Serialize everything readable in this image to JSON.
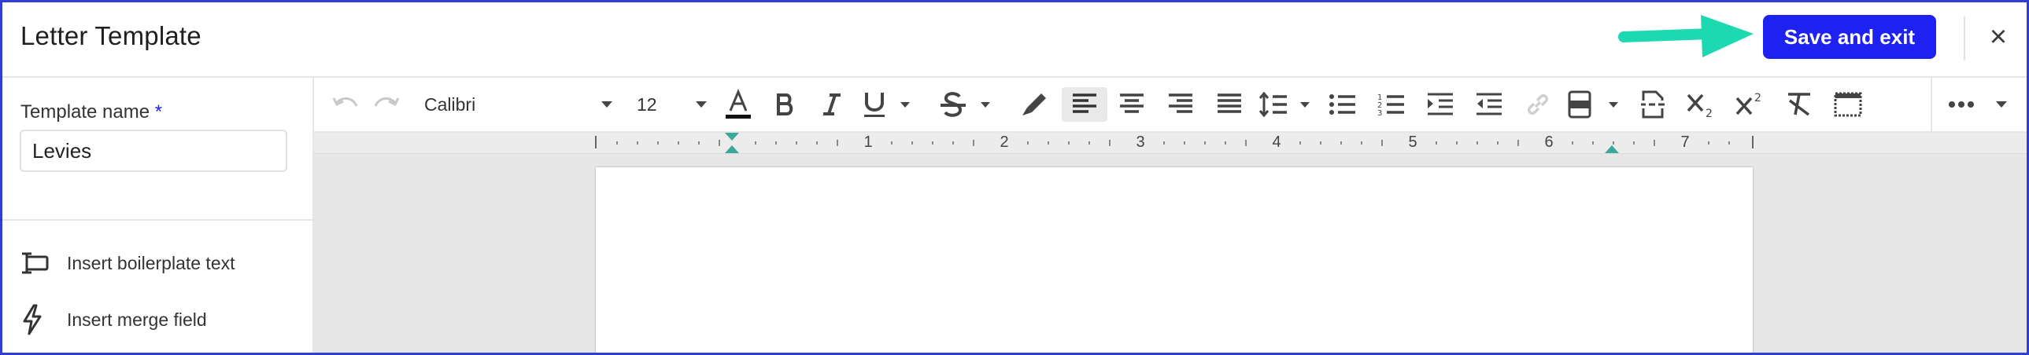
{
  "header": {
    "title": "Letter Template",
    "save_label": "Save and exit",
    "close_label": "×"
  },
  "sidebar": {
    "template_name_label": "Template name",
    "required_marker": "*",
    "template_name_value": "Levies",
    "actions": [
      {
        "label": "Insert boilerplate text",
        "icon": "boilerplate-icon"
      },
      {
        "label": "Insert merge field",
        "icon": "lightning-icon"
      }
    ]
  },
  "toolbar": {
    "font_family": "Calibri",
    "font_size": "12",
    "buttons": [
      "undo-icon",
      "redo-icon",
      "text-color-icon",
      "bold-icon",
      "italic-icon",
      "underline-icon",
      "strikethrough-icon",
      "highlight-icon",
      "align-left-icon",
      "align-center-icon",
      "align-right-icon",
      "justify-icon",
      "line-spacing-icon",
      "bullet-list-icon",
      "numbered-list-icon",
      "indent-icon",
      "outdent-icon",
      "link-icon",
      "page-break-icon",
      "header-footer-icon",
      "subscript-icon",
      "superscript-icon",
      "clear-formatting-icon",
      "table-icon",
      "more-icon"
    ],
    "active": "align-left-icon"
  },
  "ruler": {
    "numbers": [
      "1",
      "2",
      "3",
      "4",
      "5",
      "6",
      "7"
    ]
  },
  "colors": {
    "accent": "#1e22f0",
    "arrow": "#1dd9b2",
    "frame_border": "#2f3fd6",
    "ruler_marker": "#3aa89a"
  }
}
